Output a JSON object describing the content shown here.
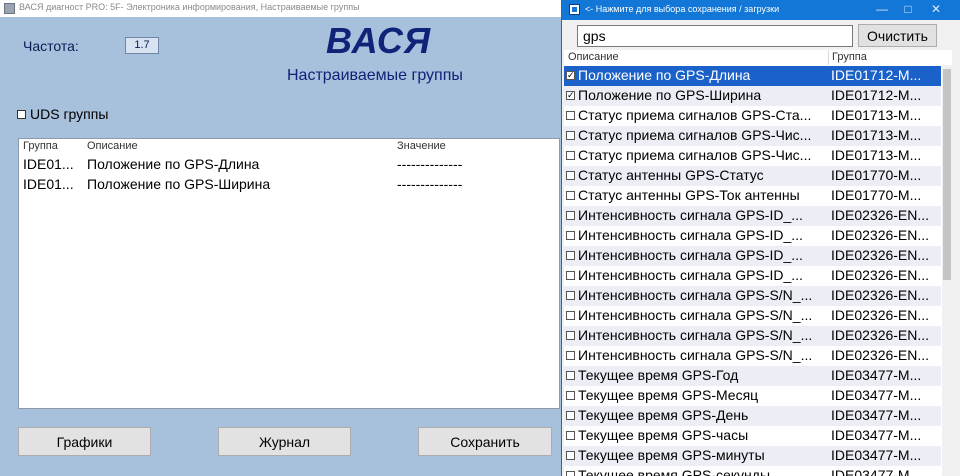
{
  "main_window": {
    "title": "ВАСЯ диагност PRO: 5F- Электроника информирования,  Настраиваемые группы",
    "frequency_label": "Частота:",
    "frequency_value": "1.7",
    "brand": "ВАСЯ",
    "subtitle": "Настраиваемые группы",
    "uds_label": "UDS группы",
    "uds_checked": false,
    "table": {
      "columns": [
        "Группа",
        "Описание",
        "Значение"
      ],
      "rows": [
        {
          "group": "IDE01...",
          "description": "Положение по GPS-Длина",
          "value": "--------------"
        },
        {
          "group": "IDE01...",
          "description": "Положение по GPS-Ширина",
          "value": "--------------"
        }
      ]
    },
    "buttons": {
      "graphs": "Графики",
      "journal": "Журнал",
      "save": "Сохранить"
    }
  },
  "popup": {
    "title": "<- Нажмите для выбора сохранения / загрузки",
    "search_value": "gps",
    "clear_label": "Очистить",
    "columns": [
      "Описание",
      "Группа"
    ],
    "items": [
      {
        "checked": true,
        "description": "Положение по GPS-Длина",
        "group": "IDE01712-M...",
        "selected": true
      },
      {
        "checked": true,
        "description": "Положение по GPS-Ширина",
        "group": "IDE01712-M..."
      },
      {
        "checked": false,
        "description": "Статус приема сигналов GPS-Ста...",
        "group": "IDE01713-M..."
      },
      {
        "checked": false,
        "description": "Статус приема сигналов GPS-Чис...",
        "group": "IDE01713-M..."
      },
      {
        "checked": false,
        "description": "Статус приема сигналов GPS-Чис...",
        "group": "IDE01713-M..."
      },
      {
        "checked": false,
        "description": "Статус антенны GPS-Статус",
        "group": "IDE01770-M..."
      },
      {
        "checked": false,
        "description": "Статус антенны GPS-Ток антенны",
        "group": "IDE01770-M..."
      },
      {
        "checked": false,
        "description": "Интенсивность сигнала GPS-ID_...",
        "group": "IDE02326-EN..."
      },
      {
        "checked": false,
        "description": "Интенсивность сигнала GPS-ID_...",
        "group": "IDE02326-EN..."
      },
      {
        "checked": false,
        "description": "Интенсивность сигнала GPS-ID_...",
        "group": "IDE02326-EN..."
      },
      {
        "checked": false,
        "description": "Интенсивность сигнала GPS-ID_...",
        "group": "IDE02326-EN..."
      },
      {
        "checked": false,
        "description": "Интенсивность сигнала GPS-S/N_...",
        "group": "IDE02326-EN..."
      },
      {
        "checked": false,
        "description": "Интенсивность сигнала GPS-S/N_...",
        "group": "IDE02326-EN..."
      },
      {
        "checked": false,
        "description": "Интенсивность сигнала GPS-S/N_...",
        "group": "IDE02326-EN..."
      },
      {
        "checked": false,
        "description": "Интенсивность сигнала GPS-S/N_...",
        "group": "IDE02326-EN..."
      },
      {
        "checked": false,
        "description": "Текущее время GPS-Год",
        "group": "IDE03477-M..."
      },
      {
        "checked": false,
        "description": "Текущее время GPS-Месяц",
        "group": "IDE03477-M..."
      },
      {
        "checked": false,
        "description": "Текущее время GPS-День",
        "group": "IDE03477-M..."
      },
      {
        "checked": false,
        "description": "Текущее время GPS-часы",
        "group": "IDE03477-M..."
      },
      {
        "checked": false,
        "description": "Текущее время GPS-минуты",
        "group": "IDE03477-M..."
      },
      {
        "checked": false,
        "description": "Текущее время GPS-секунды",
        "group": "IDE03477-M..."
      }
    ]
  },
  "colors": {
    "main_background": "#a7c0dc",
    "brand_text": "#0f2378",
    "popup_titlebar": "#1277d6",
    "selection": "#1a62c9",
    "alt_row": "#ededf6"
  },
  "icons": {
    "minimize": "minimize-icon",
    "maximize": "maximize-icon",
    "close": "close-icon",
    "check": "check-icon"
  }
}
